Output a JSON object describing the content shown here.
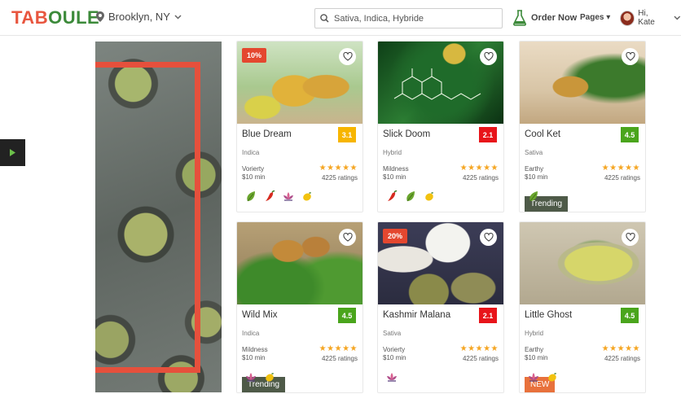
{
  "header": {
    "logo_part1": "TAB",
    "logo_part2": "OULE",
    "location": "Brooklyn, NY",
    "search_placeholder": "Sativa, Indica, Hybride",
    "order_label": "Order Now",
    "pages_label": "Pages",
    "greeting": "Hi, Kate"
  },
  "colors": {
    "brand_red": "#e8563f",
    "brand_green": "#3c8a3a",
    "rating_green": "#4aa51c",
    "rating_red": "#e8141a",
    "rating_yellow": "#f7b500"
  },
  "products": [
    {
      "name": "Blue Dream",
      "rating": "3.1",
      "rating_color": "#f7b500",
      "type": "Indica",
      "attr": "Vorierty",
      "mins": "$10 min",
      "stars": "★★★★★",
      "ratings": "4225 ratings",
      "badge": "10%",
      "ribbon": "",
      "icons": [
        "leaf-icon",
        "chili-icon",
        "lotus-icon",
        "lemon-icon"
      ]
    },
    {
      "name": "Slick Doom",
      "rating": "2.1",
      "rating_color": "#e8141a",
      "type": "Hybrid",
      "attr": "Mildness",
      "mins": "$10 min",
      "stars": "★★★★★",
      "ratings": "4225 ratings",
      "badge": "",
      "ribbon": "",
      "icons": [
        "chili-icon",
        "leaf-icon",
        "lemon-icon"
      ]
    },
    {
      "name": "Cool Ket",
      "rating": "4.5",
      "rating_color": "#4aa51c",
      "type": "Sativa",
      "attr": "Earthy",
      "mins": "$10 min",
      "stars": "★★★★★",
      "ratings": "4225 ratings",
      "badge": "",
      "ribbon": "Trending",
      "icons": [
        "leaf-icon"
      ]
    },
    {
      "name": "Wild Mix",
      "rating": "4.5",
      "rating_color": "#4aa51c",
      "type": "Indica",
      "attr": "Mildness",
      "mins": "$10 min",
      "stars": "★★★★★",
      "ratings": "4225 ratings",
      "badge": "",
      "ribbon": "Trending",
      "icons": [
        "lotus-icon",
        "lemon-icon"
      ]
    },
    {
      "name": "Kashmir Malana",
      "rating": "2.1",
      "rating_color": "#e8141a",
      "type": "Sativa",
      "attr": "Vorierty",
      "mins": "$10 min",
      "stars": "★★★★★",
      "ratings": "4225 ratings",
      "badge": "20%",
      "ribbon": "",
      "icons": [
        "lotus-icon"
      ]
    },
    {
      "name": "Little Ghost",
      "rating": "4.5",
      "rating_color": "#4aa51c",
      "type": "Hybrid",
      "attr": "Earthy",
      "mins": "$10 min",
      "stars": "★★★★★",
      "ratings": "4225 ratings",
      "badge": "",
      "ribbon": "NEW",
      "icons": [
        "lotus-icon",
        "lemon-icon"
      ]
    }
  ]
}
